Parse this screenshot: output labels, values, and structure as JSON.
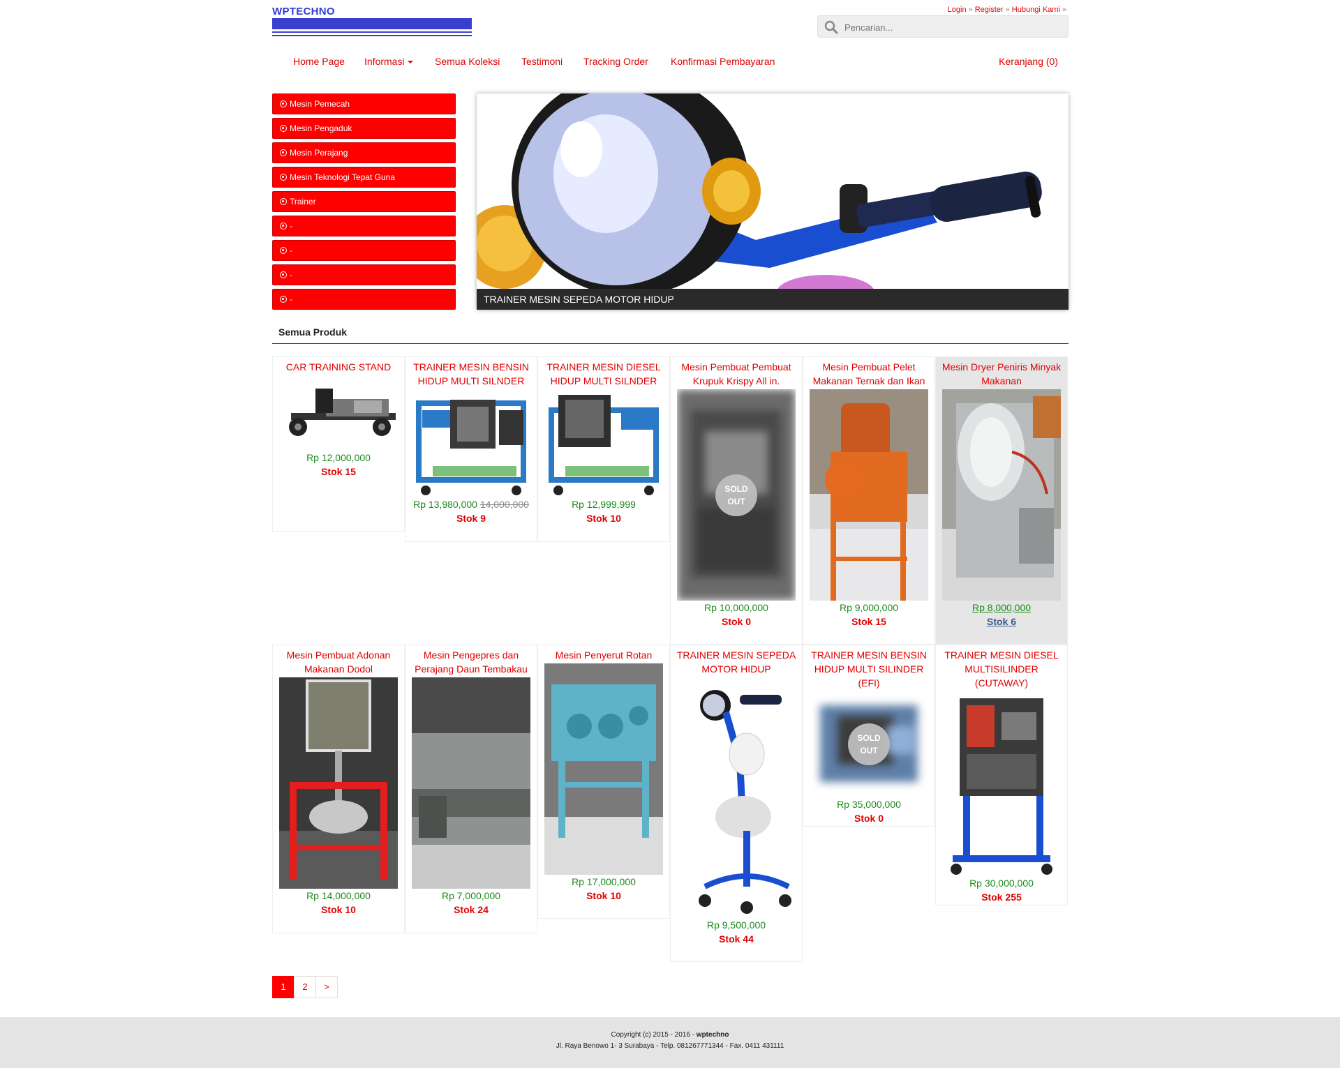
{
  "header": {
    "logo_text": "WPTECHNO",
    "links": [
      "Login",
      "Register",
      "Hubungi Kami"
    ],
    "search_placeholder": "Pencarian..."
  },
  "nav": {
    "items": [
      "Home Page",
      "Informasi",
      "Semua Koleksi",
      "Testimoni",
      "Tracking Order",
      "Konfirmasi Pembayaran"
    ],
    "cart": "Keranjang (0)"
  },
  "categories": [
    "Mesin Pemecah",
    "Mesin Pengaduk",
    "Mesin Perajang",
    "Mesin Teknologi Tepat Guna",
    "Trainer",
    "-",
    "-",
    "-",
    "-"
  ],
  "slider": {
    "caption": "TRAINER MESIN SEPEDA MOTOR HIDUP"
  },
  "section": {
    "title": "Semua Produk"
  },
  "products": [
    {
      "name": "CAR TRAINING STAND",
      "price": "Rp 12,000,000",
      "old_price": "",
      "stock": "Stok 15",
      "sold_out": false
    },
    {
      "name": "TRAINER MESIN BENSIN HIDUP MULTI SILNDER",
      "price": "Rp 13,980,000",
      "old_price": "14,000,000",
      "stock": "Stok 9",
      "sold_out": false
    },
    {
      "name": "TRAINER MESIN DIESEL HIDUP MULTI SILNDER",
      "price": "Rp 12,999,999",
      "old_price": "",
      "stock": "Stok 10",
      "sold_out": false
    },
    {
      "name": "Mesin Pembuat Pembuat Krupuk Krispy All in.",
      "price": "Rp 10,000,000",
      "old_price": "",
      "stock": "Stok 0",
      "sold_out": true,
      "badge": [
        "SOLD",
        "OUT"
      ]
    },
    {
      "name": "Mesin Pembuat Pelet Makanan Ternak dan Ikan",
      "price": "Rp 9,000,000",
      "old_price": "",
      "stock": "Stok 15",
      "sold_out": false
    },
    {
      "name": "Mesin Dryer Peniris Minyak Makanan",
      "price": "Rp 8,000,000",
      "old_price": "",
      "stock": "Stok 6",
      "sold_out": false
    },
    {
      "name": "Mesin Pembuat Adonan Makanan Dodol",
      "price": "Rp 14,000,000",
      "old_price": "",
      "stock": "Stok 10",
      "sold_out": false
    },
    {
      "name": "Mesin Pengepres dan Perajang Daun Tembakau",
      "price": "Rp 7,000,000",
      "old_price": "",
      "stock": "Stok 24",
      "sold_out": false
    },
    {
      "name": "Mesin Penyerut Rotan",
      "price": "Rp 17,000,000",
      "old_price": "",
      "stock": "Stok 10",
      "sold_out": false
    },
    {
      "name": "TRAINER MESIN SEPEDA MOTOR HIDUP",
      "price": "Rp 9,500,000",
      "old_price": "",
      "stock": "Stok 44",
      "sold_out": false
    },
    {
      "name": "TRAINER MESIN BENSIN HIDUP MULTI SILINDER (EFI)",
      "price": "Rp 35,000,000",
      "old_price": "",
      "stock": "Stok 0",
      "sold_out": true,
      "badge": [
        "SOLD",
        "OUT"
      ]
    },
    {
      "name": "TRAINER MESIN DIESEL MULTISILINDER (CUTAWAY)",
      "price": "Rp 30,000,000",
      "old_price": "",
      "stock": "Stok 255",
      "sold_out": false
    }
  ],
  "pagination": [
    "1",
    "2",
    ">"
  ],
  "footer": {
    "copyright_prefix": "Copyright (c) 2015 - 2016 - ",
    "brand": "wptechno",
    "address": "Jl. Raya Benowo 1- 3 Surabaya - Telp. 081267771344 - Fax. 0411 431111"
  }
}
